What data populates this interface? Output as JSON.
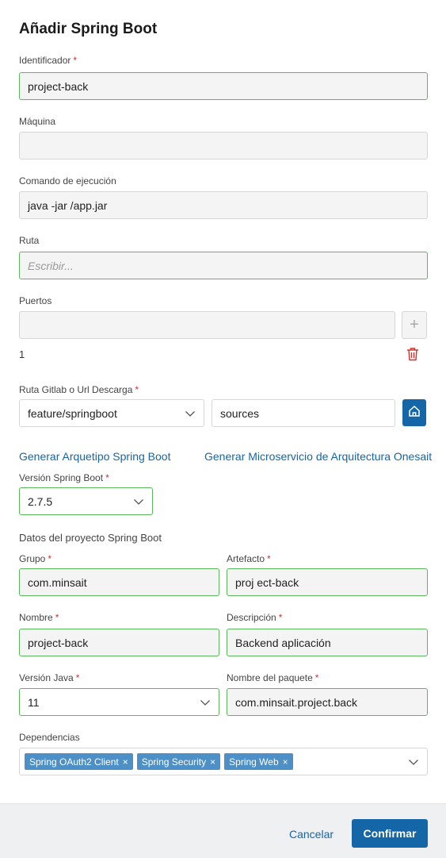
{
  "title": "Añadir Spring Boot",
  "fields": {
    "identificador": {
      "label": "Identificador",
      "value": "project-back"
    },
    "maquina": {
      "label": "Máquina",
      "value": ""
    },
    "comando": {
      "label": "Comando de ejecución",
      "value": "java -jar /app.jar"
    },
    "ruta": {
      "label": "Ruta",
      "placeholder": "Escribir..."
    },
    "puertos": {
      "label": "Puertos",
      "value": "",
      "index": "1"
    },
    "gitlab": {
      "label": "Ruta Gitlab o Url Descarga",
      "branch": "feature/springboot",
      "path": "sources"
    }
  },
  "links": {
    "arquetipo": "Generar Arquetipo Spring Boot",
    "microservicio": "Generar Microservicio de Arquitectura Onesait"
  },
  "version_spring": {
    "label": "Versión Spring Boot",
    "value": "2.7.5"
  },
  "project_section": "Datos del proyecto Spring Boot",
  "project": {
    "grupo": {
      "label": "Grupo",
      "value": "com.minsait"
    },
    "artefacto": {
      "label": "Artefacto",
      "value": "proj ect-back"
    },
    "nombre": {
      "label": "Nombre",
      "value": "project-back"
    },
    "descripcion": {
      "label": "Descripción",
      "value": "Backend aplicación"
    },
    "java": {
      "label": "Versión Java",
      "value": "11"
    },
    "paquete": {
      "label": "Nombre del paquete",
      "value": "com.minsait.project.back"
    }
  },
  "dependencias": {
    "label": "Dependencias",
    "tags": [
      "Spring OAuth2 Client",
      "Spring Security",
      "Spring Web"
    ]
  },
  "footer": {
    "cancel": "Cancelar",
    "confirm": "Confirmar"
  },
  "colors": {
    "accent": "#1566a6",
    "valid_border": "#5cb85c",
    "required": "#d32f2f",
    "tag": "#4d8fc7"
  }
}
